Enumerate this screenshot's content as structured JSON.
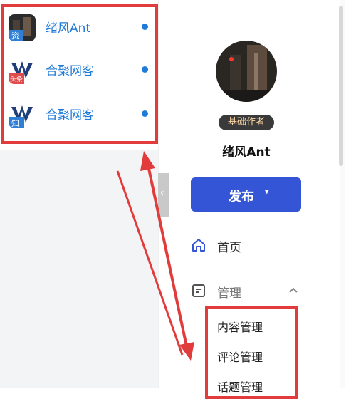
{
  "accounts": [
    {
      "name": "绪风Ant",
      "platform_icon_text": "资"
    },
    {
      "name": "合聚网客",
      "platform_icon_text": "头条"
    },
    {
      "name": "合聚网客",
      "platform_icon_text": "知"
    }
  ],
  "profile": {
    "role_badge": "基础作者",
    "name": "绪风Ant"
  },
  "publish_button": {
    "label": "发布",
    "caret": "▾"
  },
  "nav": {
    "home_label": "首页",
    "manage_label": "管理",
    "manage_items": [
      "内容管理",
      "评论管理",
      "话题管理"
    ]
  },
  "collapse_glyph": "‹",
  "colors": {
    "accent": "#3355d6",
    "account_link": "#1f7ad8",
    "annotation_red": "#e23b3b",
    "badge_bg": "#3a3a3a"
  }
}
